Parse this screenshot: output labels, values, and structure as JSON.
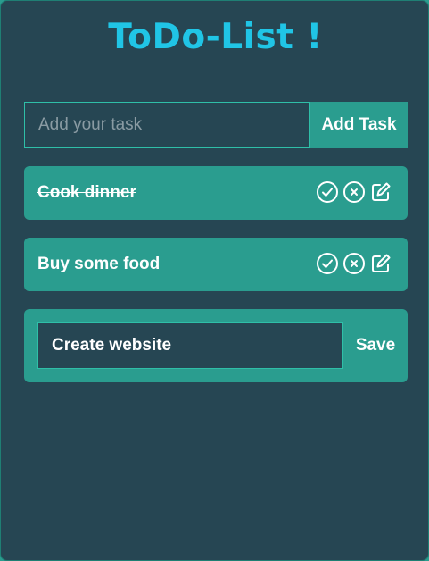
{
  "app": {
    "title": "ToDo-List !"
  },
  "add_form": {
    "placeholder": "Add your task",
    "button_label": "Add Task"
  },
  "todos": [
    {
      "text": "Cook dinner",
      "completed": true
    },
    {
      "text": "Buy some food",
      "completed": false
    }
  ],
  "edit_form": {
    "value": "Create website",
    "button_label": "Save"
  },
  "icons": {
    "complete": "check-circle-icon",
    "delete": "x-circle-icon",
    "edit": "pencil-square-icon"
  },
  "colors": {
    "background": "#264653",
    "accent": "#2a9d8f",
    "title": "#20c5e6",
    "border": "#2fbfa8",
    "text": "#ffffff"
  }
}
